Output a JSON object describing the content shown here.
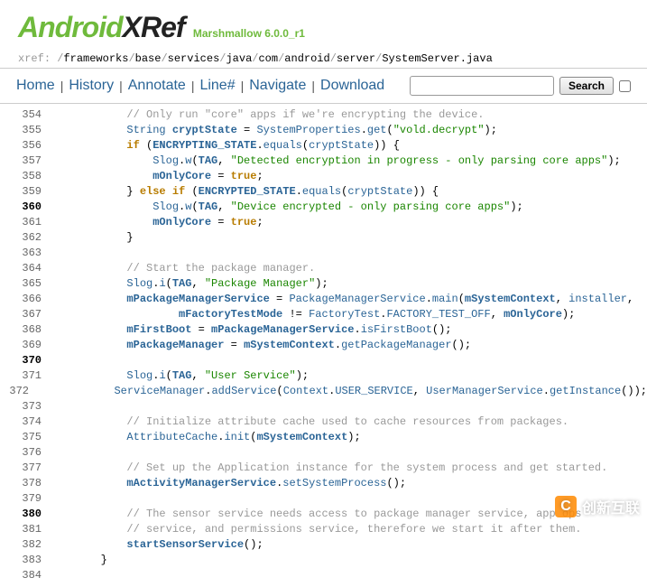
{
  "header": {
    "logo_part1": "Android",
    "logo_part2": "XRef",
    "version": "Marshmallow 6.0.0_r1"
  },
  "breadcrumb": {
    "prefix": "xref",
    "segments": [
      "frameworks",
      "base",
      "services",
      "java",
      "com",
      "android",
      "server",
      "SystemServer.java"
    ]
  },
  "nav": {
    "home": "Home",
    "history": "History",
    "annotate": "Annotate",
    "line": "Line#",
    "navigate": "Navigate",
    "download": "Download",
    "search_btn": "Search"
  },
  "code": {
    "hl_lines": [
      360,
      370,
      380
    ],
    "lines": [
      {
        "n": 354,
        "tokens": [
          {
            "t": "            ",
            "c": ""
          },
          {
            "t": "// Only run \"core\" apps if we're encrypting the device.",
            "c": "cmt"
          }
        ]
      },
      {
        "n": 355,
        "tokens": [
          {
            "t": "            ",
            "c": ""
          },
          {
            "t": "String",
            "c": "ref"
          },
          {
            "t": " ",
            "c": ""
          },
          {
            "t": "cryptState",
            "c": "def"
          },
          {
            "t": " = ",
            "c": ""
          },
          {
            "t": "SystemProperties",
            "c": "ref"
          },
          {
            "t": ".",
            "c": ""
          },
          {
            "t": "get",
            "c": "ref"
          },
          {
            "t": "(",
            "c": ""
          },
          {
            "t": "\"vold.decrypt\"",
            "c": "str"
          },
          {
            "t": ");",
            "c": ""
          }
        ]
      },
      {
        "n": 356,
        "tokens": [
          {
            "t": "            ",
            "c": ""
          },
          {
            "t": "if",
            "c": "kw"
          },
          {
            "t": " (",
            "c": ""
          },
          {
            "t": "ENCRYPTING_STATE",
            "c": "def"
          },
          {
            "t": ".",
            "c": ""
          },
          {
            "t": "equals",
            "c": "ref"
          },
          {
            "t": "(",
            "c": ""
          },
          {
            "t": "cryptState",
            "c": "ref"
          },
          {
            "t": ")) {",
            "c": ""
          }
        ]
      },
      {
        "n": 357,
        "tokens": [
          {
            "t": "                ",
            "c": ""
          },
          {
            "t": "Slog",
            "c": "ref"
          },
          {
            "t": ".",
            "c": ""
          },
          {
            "t": "w",
            "c": "ref"
          },
          {
            "t": "(",
            "c": ""
          },
          {
            "t": "TAG",
            "c": "def"
          },
          {
            "t": ", ",
            "c": ""
          },
          {
            "t": "\"Detected encryption in progress - only parsing core apps\"",
            "c": "str"
          },
          {
            "t": ");",
            "c": ""
          }
        ]
      },
      {
        "n": 358,
        "tokens": [
          {
            "t": "                ",
            "c": ""
          },
          {
            "t": "mOnlyCore",
            "c": "def"
          },
          {
            "t": " = ",
            "c": ""
          },
          {
            "t": "true",
            "c": "lit"
          },
          {
            "t": ";",
            "c": ""
          }
        ]
      },
      {
        "n": 359,
        "tokens": [
          {
            "t": "            } ",
            "c": ""
          },
          {
            "t": "else if",
            "c": "kw"
          },
          {
            "t": " (",
            "c": ""
          },
          {
            "t": "ENCRYPTED_STATE",
            "c": "def"
          },
          {
            "t": ".",
            "c": ""
          },
          {
            "t": "equals",
            "c": "ref"
          },
          {
            "t": "(",
            "c": ""
          },
          {
            "t": "cryptState",
            "c": "ref"
          },
          {
            "t": ")) {",
            "c": ""
          }
        ]
      },
      {
        "n": 360,
        "tokens": [
          {
            "t": "                ",
            "c": ""
          },
          {
            "t": "Slog",
            "c": "ref"
          },
          {
            "t": ".",
            "c": ""
          },
          {
            "t": "w",
            "c": "ref"
          },
          {
            "t": "(",
            "c": ""
          },
          {
            "t": "TAG",
            "c": "def"
          },
          {
            "t": ", ",
            "c": ""
          },
          {
            "t": "\"Device encrypted - only parsing core apps\"",
            "c": "str"
          },
          {
            "t": ");",
            "c": ""
          }
        ]
      },
      {
        "n": 361,
        "tokens": [
          {
            "t": "                ",
            "c": ""
          },
          {
            "t": "mOnlyCore",
            "c": "def"
          },
          {
            "t": " = ",
            "c": ""
          },
          {
            "t": "true",
            "c": "lit"
          },
          {
            "t": ";",
            "c": ""
          }
        ]
      },
      {
        "n": 362,
        "tokens": [
          {
            "t": "            }",
            "c": ""
          }
        ]
      },
      {
        "n": 363,
        "tokens": [
          {
            "t": " ",
            "c": ""
          }
        ]
      },
      {
        "n": 364,
        "tokens": [
          {
            "t": "            ",
            "c": ""
          },
          {
            "t": "// Start the package manager.",
            "c": "cmt"
          }
        ]
      },
      {
        "n": 365,
        "tokens": [
          {
            "t": "            ",
            "c": ""
          },
          {
            "t": "Slog",
            "c": "ref"
          },
          {
            "t": ".",
            "c": ""
          },
          {
            "t": "i",
            "c": "ref"
          },
          {
            "t": "(",
            "c": ""
          },
          {
            "t": "TAG",
            "c": "def"
          },
          {
            "t": ", ",
            "c": ""
          },
          {
            "t": "\"Package Manager\"",
            "c": "str"
          },
          {
            "t": ");",
            "c": ""
          }
        ]
      },
      {
        "n": 366,
        "tokens": [
          {
            "t": "            ",
            "c": ""
          },
          {
            "t": "mPackageManagerService",
            "c": "def"
          },
          {
            "t": " = ",
            "c": ""
          },
          {
            "t": "PackageManagerService",
            "c": "ref"
          },
          {
            "t": ".",
            "c": ""
          },
          {
            "t": "main",
            "c": "ref"
          },
          {
            "t": "(",
            "c": ""
          },
          {
            "t": "mSystemContext",
            "c": "def"
          },
          {
            "t": ", ",
            "c": ""
          },
          {
            "t": "installer",
            "c": "ref"
          },
          {
            "t": ",",
            "c": ""
          }
        ]
      },
      {
        "n": 367,
        "tokens": [
          {
            "t": "                    ",
            "c": ""
          },
          {
            "t": "mFactoryTestMode",
            "c": "def"
          },
          {
            "t": " != ",
            "c": ""
          },
          {
            "t": "FactoryTest",
            "c": "ref"
          },
          {
            "t": ".",
            "c": ""
          },
          {
            "t": "FACTORY_TEST_OFF",
            "c": "ref"
          },
          {
            "t": ", ",
            "c": ""
          },
          {
            "t": "mOnlyCore",
            "c": "def"
          },
          {
            "t": ");",
            "c": ""
          }
        ]
      },
      {
        "n": 368,
        "tokens": [
          {
            "t": "            ",
            "c": ""
          },
          {
            "t": "mFirstBoot",
            "c": "def"
          },
          {
            "t": " = ",
            "c": ""
          },
          {
            "t": "mPackageManagerService",
            "c": "def"
          },
          {
            "t": ".",
            "c": ""
          },
          {
            "t": "isFirstBoot",
            "c": "ref"
          },
          {
            "t": "();",
            "c": ""
          }
        ]
      },
      {
        "n": 369,
        "tokens": [
          {
            "t": "            ",
            "c": ""
          },
          {
            "t": "mPackageManager",
            "c": "def"
          },
          {
            "t": " = ",
            "c": ""
          },
          {
            "t": "mSystemContext",
            "c": "def"
          },
          {
            "t": ".",
            "c": ""
          },
          {
            "t": "getPackageManager",
            "c": "ref"
          },
          {
            "t": "();",
            "c": ""
          }
        ]
      },
      {
        "n": 370,
        "tokens": [
          {
            "t": " ",
            "c": ""
          }
        ]
      },
      {
        "n": 371,
        "tokens": [
          {
            "t": "            ",
            "c": ""
          },
          {
            "t": "Slog",
            "c": "ref"
          },
          {
            "t": ".",
            "c": ""
          },
          {
            "t": "i",
            "c": "ref"
          },
          {
            "t": "(",
            "c": ""
          },
          {
            "t": "TAG",
            "c": "def"
          },
          {
            "t": ", ",
            "c": ""
          },
          {
            "t": "\"User Service\"",
            "c": "str"
          },
          {
            "t": ");",
            "c": ""
          }
        ]
      },
      {
        "n": 372,
        "tokens": [
          {
            "t": "            ",
            "c": ""
          },
          {
            "t": "ServiceManager",
            "c": "ref"
          },
          {
            "t": ".",
            "c": ""
          },
          {
            "t": "addService",
            "c": "ref"
          },
          {
            "t": "(",
            "c": ""
          },
          {
            "t": "Context",
            "c": "ref"
          },
          {
            "t": ".",
            "c": ""
          },
          {
            "t": "USER_SERVICE",
            "c": "ref"
          },
          {
            "t": ", ",
            "c": ""
          },
          {
            "t": "UserManagerService",
            "c": "ref"
          },
          {
            "t": ".",
            "c": ""
          },
          {
            "t": "getInstance",
            "c": "ref"
          },
          {
            "t": "());",
            "c": ""
          }
        ]
      },
      {
        "n": 373,
        "tokens": [
          {
            "t": " ",
            "c": ""
          }
        ]
      },
      {
        "n": 374,
        "tokens": [
          {
            "t": "            ",
            "c": ""
          },
          {
            "t": "// Initialize attribute cache used to cache resources from packages.",
            "c": "cmt"
          }
        ]
      },
      {
        "n": 375,
        "tokens": [
          {
            "t": "            ",
            "c": ""
          },
          {
            "t": "AttributeCache",
            "c": "ref"
          },
          {
            "t": ".",
            "c": ""
          },
          {
            "t": "init",
            "c": "ref"
          },
          {
            "t": "(",
            "c": ""
          },
          {
            "t": "mSystemContext",
            "c": "def"
          },
          {
            "t": ");",
            "c": ""
          }
        ]
      },
      {
        "n": 376,
        "tokens": [
          {
            "t": " ",
            "c": ""
          }
        ]
      },
      {
        "n": 377,
        "tokens": [
          {
            "t": "            ",
            "c": ""
          },
          {
            "t": "// Set up the Application instance for the system process and get started.",
            "c": "cmt"
          }
        ]
      },
      {
        "n": 378,
        "tokens": [
          {
            "t": "            ",
            "c": ""
          },
          {
            "t": "mActivityManagerService",
            "c": "def"
          },
          {
            "t": ".",
            "c": ""
          },
          {
            "t": "setSystemProcess",
            "c": "ref"
          },
          {
            "t": "();",
            "c": ""
          }
        ]
      },
      {
        "n": 379,
        "tokens": [
          {
            "t": " ",
            "c": ""
          }
        ]
      },
      {
        "n": 380,
        "tokens": [
          {
            "t": "            ",
            "c": ""
          },
          {
            "t": "// The sensor service needs access to package manager service, app ops",
            "c": "cmt"
          }
        ]
      },
      {
        "n": 381,
        "tokens": [
          {
            "t": "            ",
            "c": ""
          },
          {
            "t": "// service, and permissions service, therefore we start it after them.",
            "c": "cmt"
          }
        ]
      },
      {
        "n": 382,
        "tokens": [
          {
            "t": "            ",
            "c": ""
          },
          {
            "t": "startSensorService",
            "c": "def"
          },
          {
            "t": "();",
            "c": ""
          }
        ]
      },
      {
        "n": 383,
        "tokens": [
          {
            "t": "        }",
            "c": ""
          }
        ]
      },
      {
        "n": 384,
        "tokens": [
          {
            "t": " ",
            "c": ""
          }
        ]
      }
    ]
  },
  "watermark": {
    "text": "创新互联",
    "letter": "C"
  }
}
